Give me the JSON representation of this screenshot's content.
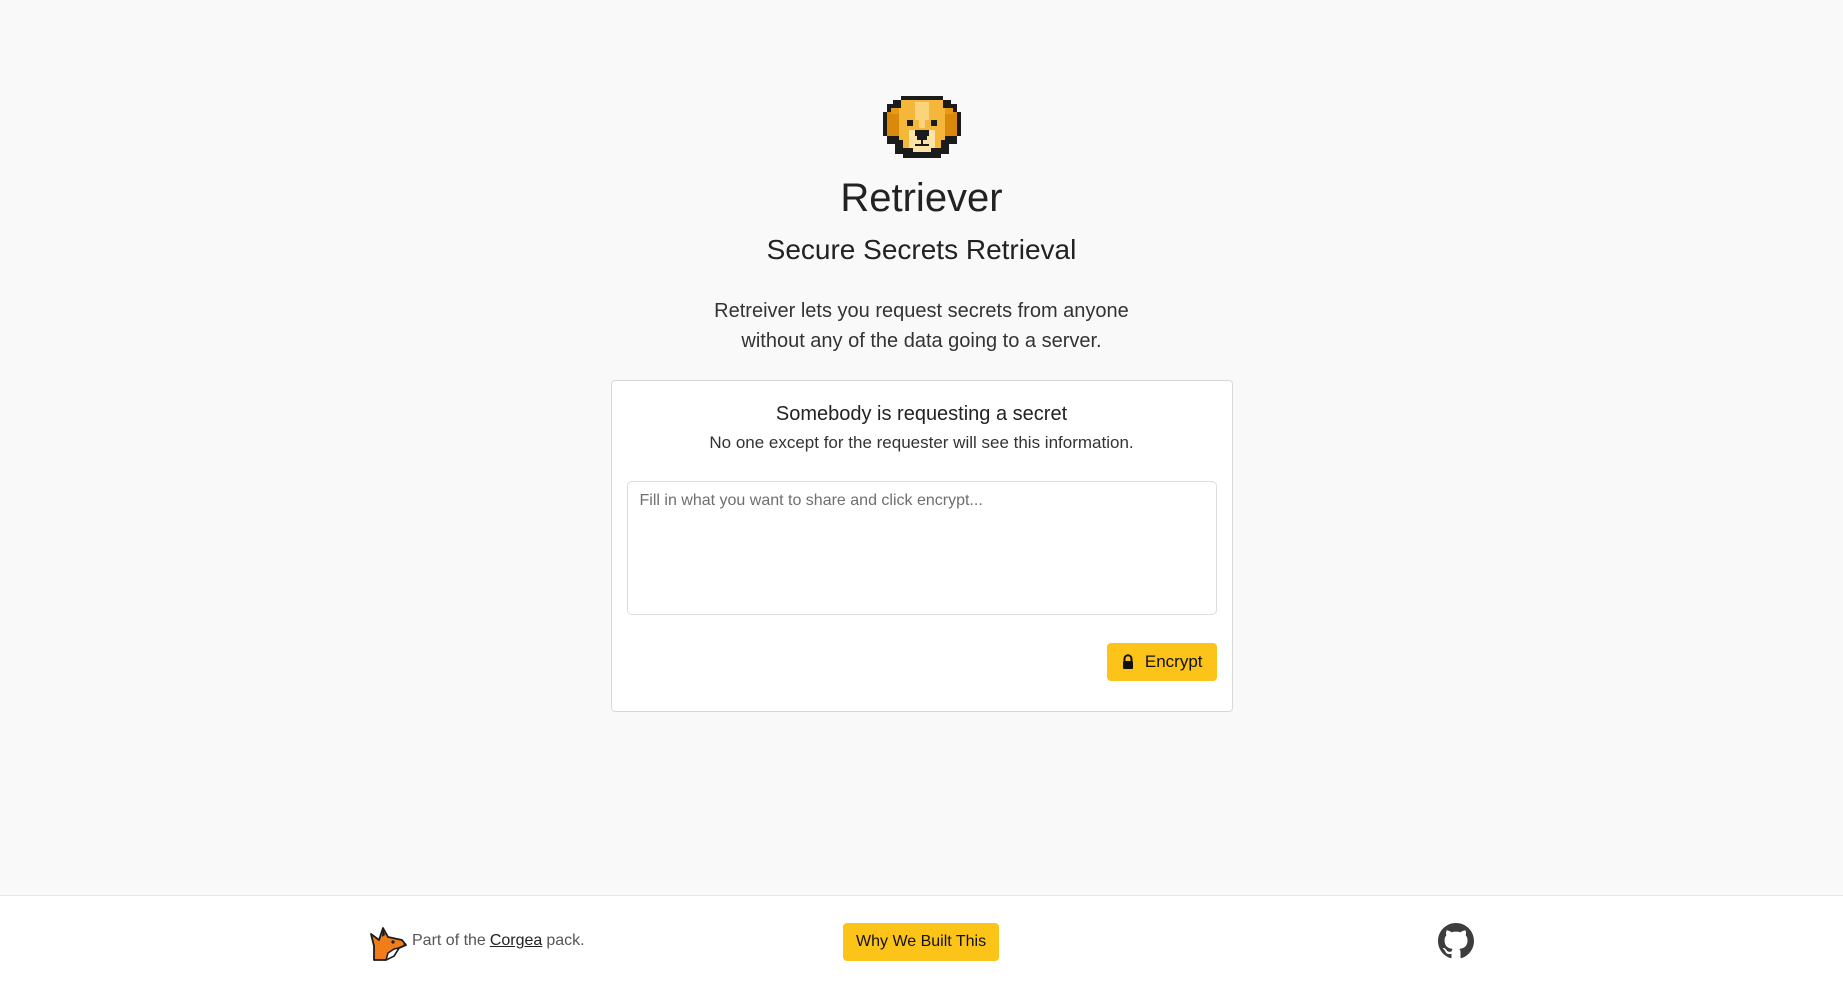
{
  "app": {
    "title": "Retriever",
    "subtitle": "Secure Secrets Retrieval",
    "intro_line1": "Retreiver lets you request secrets from anyone",
    "intro_line2": "without any of the data going to a server.",
    "logo_icon": "golden-retriever-icon"
  },
  "card": {
    "title": "Somebody is requesting a secret",
    "note": "No one except for the requester will see this information.",
    "secret_placeholder": "Fill in what you want to share and click encrypt...",
    "secret_value": "",
    "encrypt_label": "Encrypt",
    "encrypt_icon": "lock-icon"
  },
  "footer": {
    "prefix": "Part of the",
    "link_text": "Corgea",
    "suffix": "pack.",
    "why_label": "Why We Built This",
    "fox_icon": "fox-icon",
    "github_icon": "github-icon"
  },
  "colors": {
    "accent": "#fcc419",
    "background": "#f9f9f9",
    "card_background": "#ffffff"
  }
}
